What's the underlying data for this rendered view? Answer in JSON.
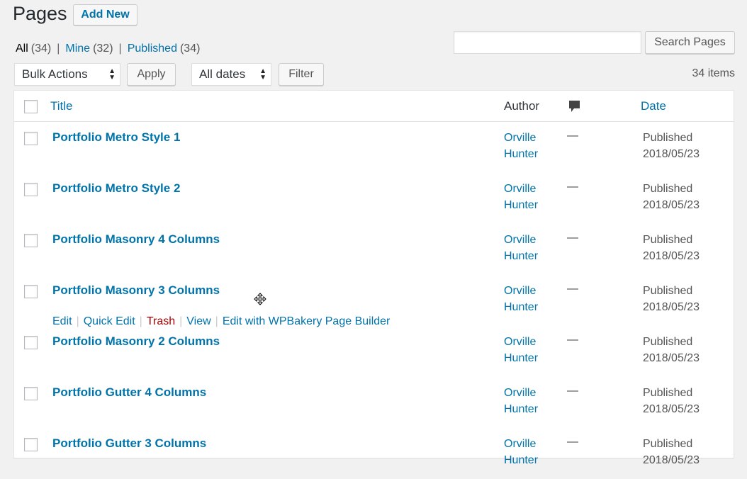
{
  "header": {
    "title": "Pages",
    "add_new_label": "Add New"
  },
  "views": [
    {
      "label": "All",
      "count": "(34)"
    },
    {
      "label": "Mine",
      "count": "(32)"
    },
    {
      "label": "Published",
      "count": "(34)"
    }
  ],
  "views_separator": "|",
  "search": {
    "value": "",
    "button_label": "Search Pages"
  },
  "tablenav": {
    "bulk_actions_selected": "Bulk Actions",
    "apply_label": "Apply",
    "dates_selected": "All dates",
    "filter_label": "Filter",
    "items_count": "34 items"
  },
  "columns": {
    "title": "Title",
    "author": "Author",
    "comments_icon": "comment-bubble-icon",
    "date": "Date"
  },
  "row_actions": {
    "edit": "Edit",
    "quick_edit": "Quick Edit",
    "trash": "Trash",
    "view": "View",
    "edit_with_builder": "Edit with WPBakery Page Builder",
    "separator": "|"
  },
  "rows": [
    {
      "title": "Portfolio Metro Style 1",
      "author_first": "Orville",
      "author_last": "Hunter",
      "comments": "—",
      "status": "Published",
      "date": "2018/05/23"
    },
    {
      "title": "Portfolio Metro Style 2",
      "author_first": "Orville",
      "author_last": "Hunter",
      "comments": "—",
      "status": "Published",
      "date": "2018/05/23"
    },
    {
      "title": "Portfolio Masonry 4 Columns",
      "author_first": "Orville",
      "author_last": "Hunter",
      "comments": "—",
      "status": "Published",
      "date": "2018/05/23"
    },
    {
      "title": "Portfolio Masonry 3 Columns",
      "author_first": "Orville",
      "author_last": "Hunter",
      "comments": "—",
      "status": "Published",
      "date": "2018/05/23"
    },
    {
      "title": "Portfolio Masonry 2 Columns",
      "author_first": "Orville",
      "author_last": "Hunter",
      "comments": "—",
      "status": "Published",
      "date": "2018/05/23"
    },
    {
      "title": "Portfolio Gutter 4 Columns",
      "author_first": "Orville",
      "author_last": "Hunter",
      "comments": "—",
      "status": "Published",
      "date": "2018/05/23"
    },
    {
      "title": "Portfolio Gutter 3 Columns",
      "author_first": "Orville",
      "author_last": "Hunter",
      "comments": "—",
      "status": "Published",
      "date": "2018/05/23"
    }
  ],
  "colors": {
    "link": "#0073aa",
    "trash": "#a00",
    "background": "#f1f1f1"
  }
}
